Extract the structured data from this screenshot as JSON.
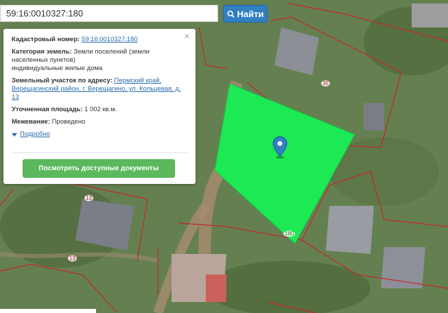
{
  "search": {
    "value": "59:16:0010327:180",
    "button_label": "Найти"
  },
  "panel": {
    "cad_label": "Кадастровый номер:",
    "cad_value": "59:16:0010327:180",
    "category_label": "Категория земель:",
    "category_value_line1": "Земли поселений (земли",
    "category_value_line2": "населенных пунктов)",
    "category_value_line3": "индивидуальные жилые дома",
    "address_label": "Земельный участок по адресу:",
    "address_line1": "Пермский край,",
    "address_line2": "Верещагинский район, г. Верещагино, ул. Кольцевая, д.",
    "address_line3": "13",
    "area_label": "Уточненная площадь:",
    "area_value": "1 002 кв.м.",
    "survey_label": "Межевание:",
    "survey_value": "Проведено",
    "more_label": "Подробно",
    "docs_button": "Посмотреть доступные документы",
    "close": "×"
  },
  "map": {
    "labels": {
      "n35": "35",
      "n13a": "13",
      "n13b": "13",
      "n180": "180"
    },
    "colors": {
      "parcel": "#1de954",
      "boundary": "#c4262e",
      "pin": "#2f7fc1"
    }
  }
}
